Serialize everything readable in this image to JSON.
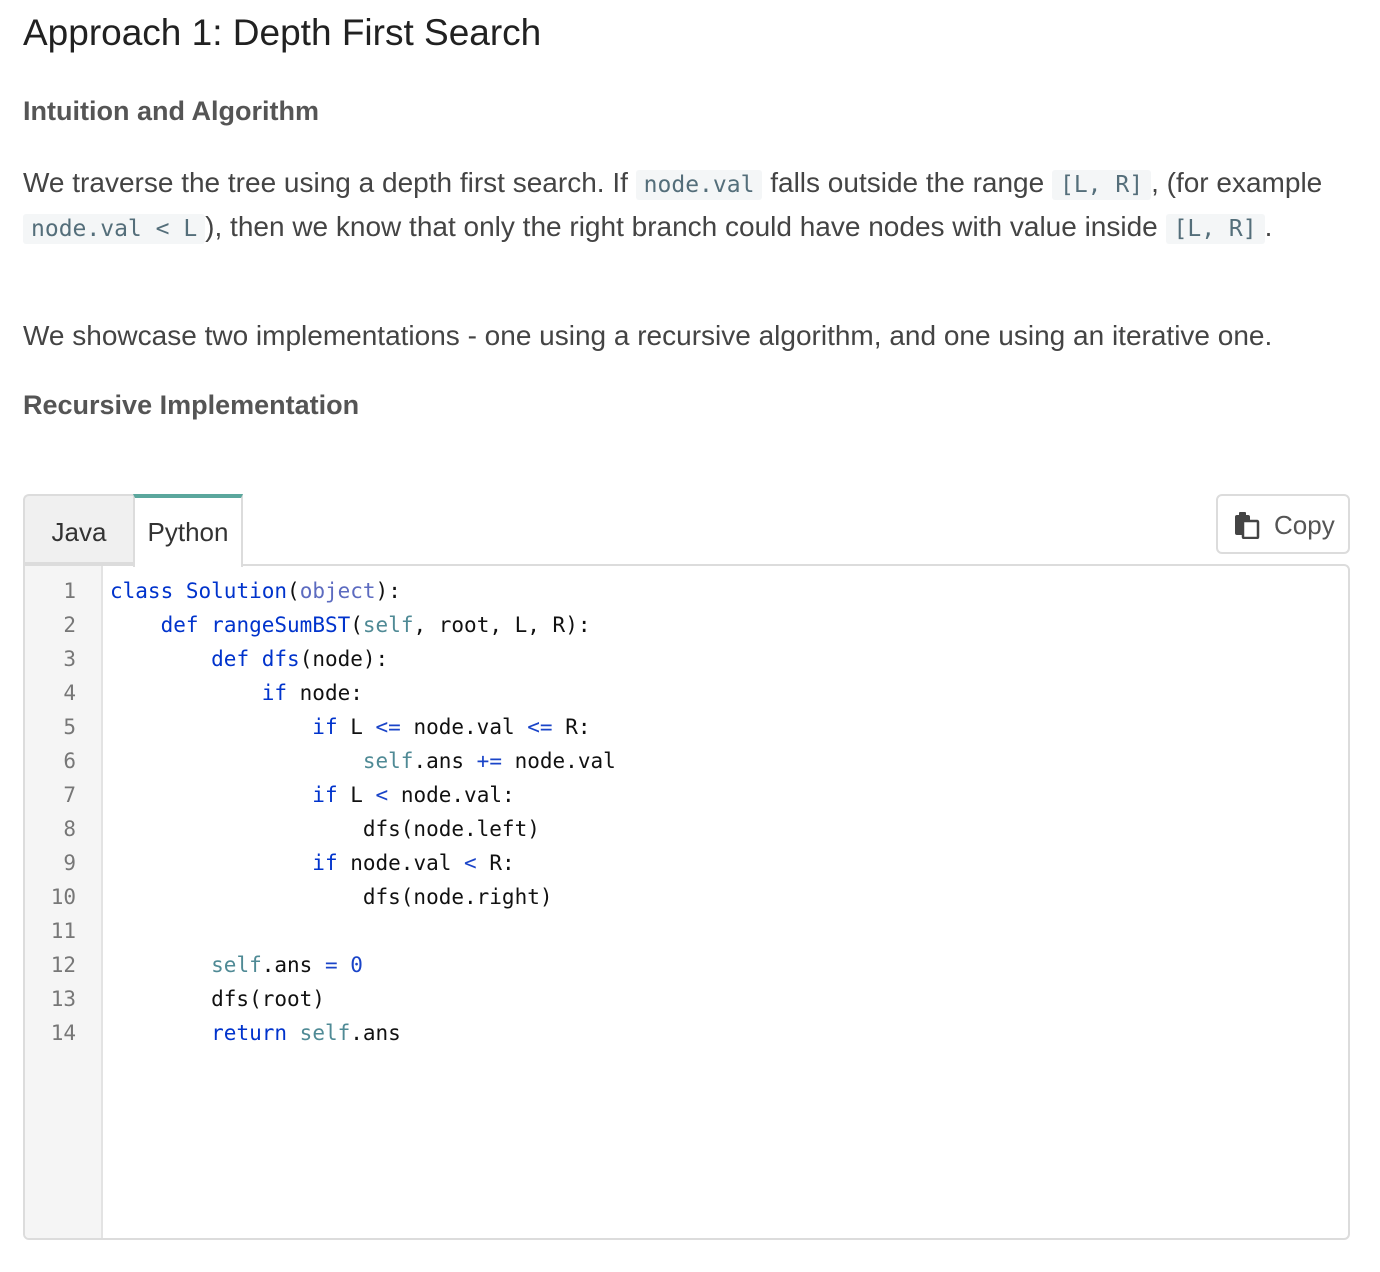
{
  "title": "Approach 1: Depth First Search",
  "section1": {
    "heading": "Intuition and Algorithm",
    "para1": {
      "t1": "We traverse the tree using a depth first search. If ",
      "c1": "node.val",
      "t2": " falls outside the range ",
      "c2": "[L, R]",
      "t3": ", (for example ",
      "c3": "node.val < L",
      "t4": "), then we know that only the right branch could have nodes with value inside ",
      "c4": "[L, R]",
      "t5": "."
    },
    "para2": "We showcase two implementations - one using a recursive algorithm, and one using an iterative one."
  },
  "section2": {
    "heading": "Recursive Implementation"
  },
  "code_widget": {
    "tabs": [
      "Java",
      "Python"
    ],
    "active_tab": "Python",
    "copy_label": "Copy",
    "line_numbers": [
      "1",
      "2",
      "3",
      "4",
      "5",
      "6",
      "7",
      "8",
      "9",
      "10",
      "11",
      "12",
      "13",
      "14"
    ],
    "code_lines": [
      "class Solution(object):",
      "    def rangeSumBST(self, root, L, R):",
      "        def dfs(node):",
      "            if node:",
      "                if L <= node.val <= R:",
      "                    self.ans += node.val",
      "                if L < node.val:",
      "                    dfs(node.left)",
      "                if node.val < R:",
      "                    dfs(node.right)",
      "",
      "        self.ans = 0",
      "        dfs(root)",
      "        return self.ans"
    ]
  },
  "colors": {
    "tab_accent": "#5ba79d",
    "keyword": "#0033cc",
    "self": "#4f8a95",
    "inline_code": "#546e7a"
  },
  "icons": {
    "copy": "clipboard-icon"
  }
}
